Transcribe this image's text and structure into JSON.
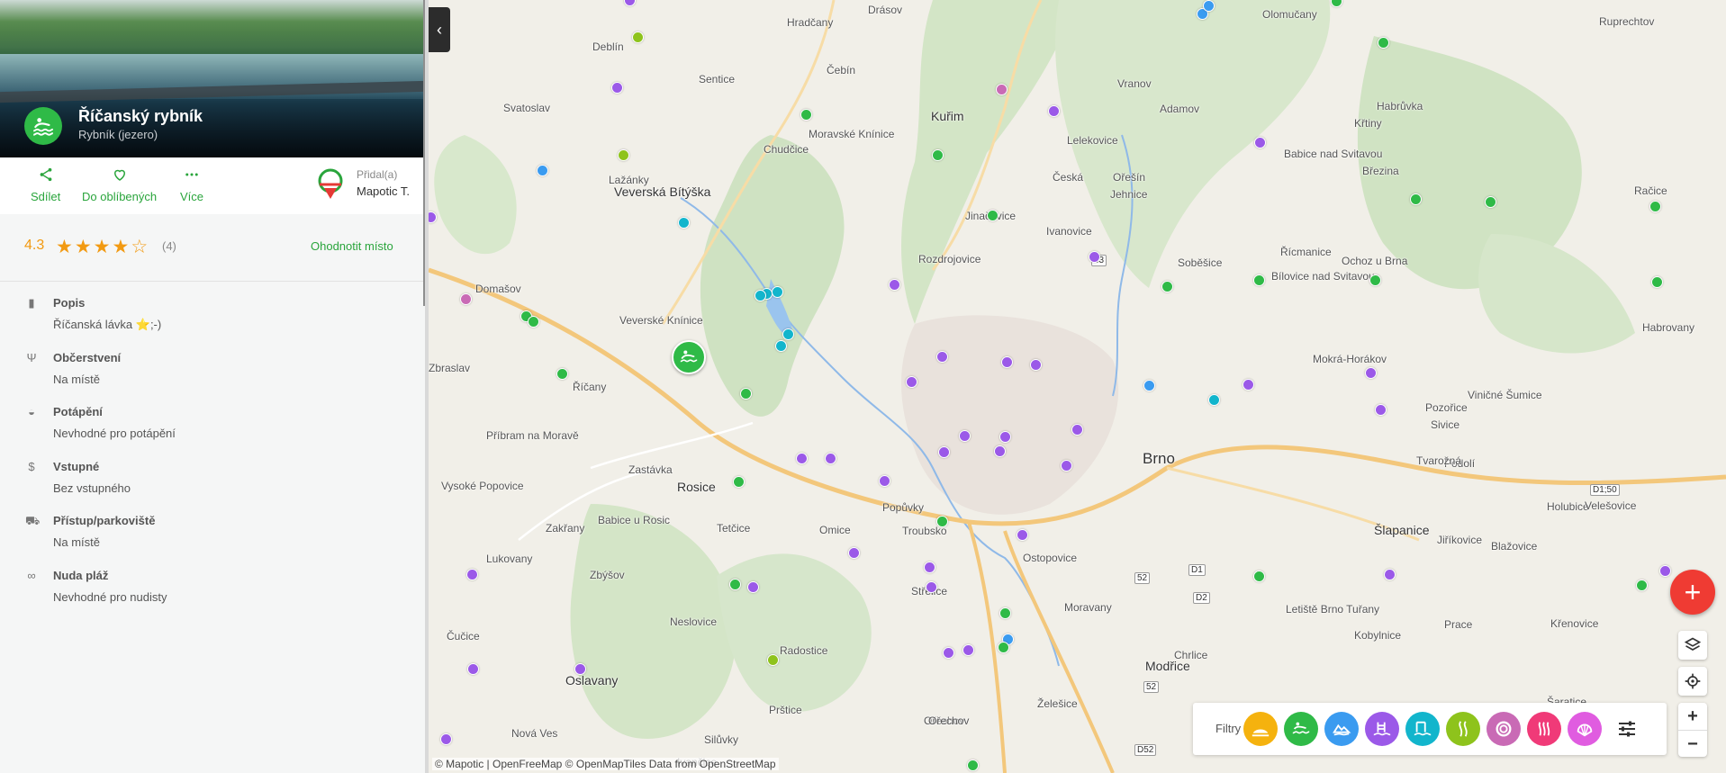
{
  "place": {
    "title": "Říčanský rybník",
    "type": "Rybník (jezero)",
    "icon": "lake-swimmer-icon"
  },
  "actions": {
    "share": "Sdílet",
    "favorite": "Do oblíbených",
    "more": "Více",
    "added_by_label": "Přidal(a)",
    "added_by_name": "Mapotic T."
  },
  "rating": {
    "value": "4.3",
    "stars": 4,
    "count": "(4)",
    "rate_label": "Ohodnotit místo"
  },
  "details": [
    {
      "icon": "clipboard-icon",
      "title": "Popis",
      "value": "Říčanská lávka ⭐;-)"
    },
    {
      "icon": "fork-knife-icon",
      "title": "Občerstvení",
      "value": "Na místě"
    },
    {
      "icon": "diver-icon",
      "title": "Potápění",
      "value": "Nevhodné pro potápění"
    },
    {
      "icon": "dollar-icon",
      "title": "Vstupné",
      "value": "Bez vstupného"
    },
    {
      "icon": "car-icon",
      "title": "Přístup/parkoviště",
      "value": "Na místě"
    },
    {
      "icon": "sunglasses-icon",
      "title": "Nuda pláž",
      "value": "Nevhodné pro nudisty"
    }
  ],
  "map": {
    "places": [
      {
        "name": "Hradčany",
        "size": "n"
      },
      {
        "name": "Drásov",
        "size": "n"
      },
      {
        "name": "Olomučany",
        "size": "n"
      },
      {
        "name": "Ruprechtov",
        "size": "n"
      },
      {
        "name": "Deblín",
        "size": "n"
      },
      {
        "name": "Sentice",
        "size": "n"
      },
      {
        "name": "Čebín",
        "size": "n"
      },
      {
        "name": "Vranov",
        "size": "n"
      },
      {
        "name": "Adamov",
        "size": "n"
      },
      {
        "name": "Habrůvka",
        "size": "n"
      },
      {
        "name": "Svatoslav",
        "size": "n"
      },
      {
        "name": "Kuřim",
        "size": "big"
      },
      {
        "name": "Moravské Knínice",
        "size": "n"
      },
      {
        "name": "Lelekovice",
        "size": "n"
      },
      {
        "name": "Křtiny",
        "size": "n"
      },
      {
        "name": "Lažánky",
        "size": "n"
      },
      {
        "name": "Chudčice",
        "size": "n"
      },
      {
        "name": "Babice nad Svitavou",
        "size": "n"
      },
      {
        "name": "Česká",
        "size": "n"
      },
      {
        "name": "Ořešín",
        "size": "n"
      },
      {
        "name": "Březina",
        "size": "n"
      },
      {
        "name": "Veverská Bítýška",
        "size": "big"
      },
      {
        "name": "Jehnice",
        "size": "n"
      },
      {
        "name": "Račice",
        "size": "n"
      },
      {
        "name": "Jinačovice",
        "size": "n"
      },
      {
        "name": "Ivanovice",
        "size": "n"
      },
      {
        "name": "Domašov",
        "size": "n"
      },
      {
        "name": "Rozdrojovice",
        "size": "n"
      },
      {
        "name": "Řícmanice",
        "size": "n"
      },
      {
        "name": "Ochoz u Brna",
        "size": "n"
      },
      {
        "name": "Soběšice",
        "size": "n"
      },
      {
        "name": "Bílovice nad Svitavou",
        "size": "n"
      },
      {
        "name": "Veverské Knínice",
        "size": "n"
      },
      {
        "name": "Habrovany",
        "size": "n"
      },
      {
        "name": "Zbraslav",
        "size": "n"
      },
      {
        "name": "Říčany",
        "size": "n"
      },
      {
        "name": "Mokrá-Horákov",
        "size": "n"
      },
      {
        "name": "Viničné Šumice",
        "size": "n"
      },
      {
        "name": "Pozořice",
        "size": "n"
      },
      {
        "name": "Sivice",
        "size": "n"
      },
      {
        "name": "Příbram na Moravě",
        "size": "n"
      },
      {
        "name": "Brno",
        "size": "city"
      },
      {
        "name": "Podolí",
        "size": "n"
      },
      {
        "name": "Tvarožná",
        "size": "n"
      },
      {
        "name": "Zastávka",
        "size": "n"
      },
      {
        "name": "Vysoké Popovice",
        "size": "n"
      },
      {
        "name": "Rosice",
        "size": "big"
      },
      {
        "name": "Popůvky",
        "size": "n"
      },
      {
        "name": "Holubice",
        "size": "n"
      },
      {
        "name": "Velešovice",
        "size": "n"
      },
      {
        "name": "Babice u Rosic",
        "size": "n"
      },
      {
        "name": "Zakřany",
        "size": "n"
      },
      {
        "name": "Tetčice",
        "size": "n"
      },
      {
        "name": "Omice",
        "size": "n"
      },
      {
        "name": "Troubsko",
        "size": "n"
      },
      {
        "name": "Šlapanice",
        "size": "big"
      },
      {
        "name": "Jiříkovice",
        "size": "n"
      },
      {
        "name": "Blažovice",
        "size": "n"
      },
      {
        "name": "Lukovany",
        "size": "n"
      },
      {
        "name": "Ostopovice",
        "size": "n"
      },
      {
        "name": "Ořechov",
        "size": "n"
      },
      {
        "name": "Moravany",
        "size": "n"
      },
      {
        "name": "Letiště Brno Tuřany",
        "size": "n"
      },
      {
        "name": "Ivančice",
        "size": "n"
      },
      {
        "name": "Zbýšov",
        "size": "n"
      },
      {
        "name": "Střelice",
        "size": "n"
      },
      {
        "name": "Neslovice",
        "size": "n"
      },
      {
        "name": "Čučice",
        "size": "n"
      },
      {
        "name": "Radostice",
        "size": "n"
      },
      {
        "name": "Chrlice",
        "size": "n"
      },
      {
        "name": "Kobylnice",
        "size": "n"
      },
      {
        "name": "Prace",
        "size": "n"
      },
      {
        "name": "Křenovice",
        "size": "n"
      },
      {
        "name": "Oslavany",
        "size": "big"
      },
      {
        "name": "Modřice",
        "size": "big"
      },
      {
        "name": "Želešice",
        "size": "n"
      },
      {
        "name": "Prštice",
        "size": "n"
      },
      {
        "name": "Šaratice",
        "size": "n"
      },
      {
        "name": "Nová Ves",
        "size": "n"
      },
      {
        "name": "Silůvky",
        "size": "n"
      },
      {
        "name": "Ořechov",
        "size": "n"
      }
    ],
    "road_labels": [
      "43",
      "D1;50",
      "52",
      "D1",
      "D2",
      "52",
      "D52"
    ],
    "attribution": "© Mapotic | OpenFreeMap © OpenMapTiles Data from OpenStreetMap"
  },
  "filters": {
    "label": "Filtry",
    "items": [
      {
        "name": "beach",
        "color": "#f5b20e"
      },
      {
        "name": "lake",
        "color": "#2fba47"
      },
      {
        "name": "quarry",
        "color": "#3a9bf0"
      },
      {
        "name": "pool",
        "color": "#9b59e8"
      },
      {
        "name": "swimming-pool",
        "color": "#12b5cc"
      },
      {
        "name": "river",
        "color": "#8ec31c"
      },
      {
        "name": "aquapark",
        "color": "#c96ab5"
      },
      {
        "name": "thermal",
        "color": "#f03a78"
      },
      {
        "name": "sea",
        "color": "#e05ce0"
      }
    ]
  },
  "controls": {
    "add": "+",
    "zoom_in": "+",
    "zoom_out": "−"
  }
}
